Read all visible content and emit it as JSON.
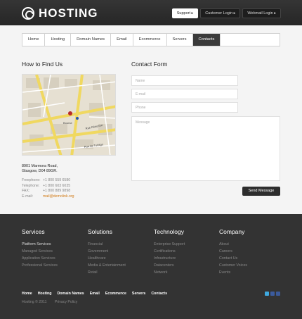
{
  "header": {
    "brand": "HOSTING",
    "links": [
      "Support",
      "Customer Login",
      "Webmail Login"
    ]
  },
  "nav": {
    "items": [
      "Home",
      "Hosting",
      "Domain Names",
      "Email",
      "Ecommerce",
      "Servers",
      "Contacts"
    ],
    "active": "Contacts"
  },
  "find_us": {
    "title": "How to Find Us",
    "address_line1": "8901 Marmora Road,",
    "address_line2": "Glasgow, D04 89GR.",
    "contacts": [
      {
        "label": "Freephone:",
        "value": "+1 800 559 6580"
      },
      {
        "label": "Telephone:",
        "value": "+1 800 603 6035"
      },
      {
        "label": "FAX:",
        "value": "+1 800 889 9898"
      },
      {
        "label": "E-mail:",
        "value": "mail@demolink.org"
      }
    ],
    "map_labels": [
      "Bourse",
      "Rue Réaumur",
      "Rue de Turbigo"
    ]
  },
  "form": {
    "title": "Contact Form",
    "name_placeholder": "Name",
    "email_placeholder": "E-mail",
    "phone_placeholder": "Phone",
    "message_placeholder": "Message",
    "send_label": "Send Message"
  },
  "footer": {
    "columns": [
      {
        "title": "Services",
        "items": [
          "Platform Services",
          "Managed Services",
          "Application Services",
          "Professional Services"
        ]
      },
      {
        "title": "Solutions",
        "items": [
          "Financial",
          "Government",
          "Healthcare",
          "Media & Entertainment",
          "Retail"
        ]
      },
      {
        "title": "Technology",
        "items": [
          "Enterprise Support",
          "Certifications",
          "Infrastructure",
          "Datacenters",
          "Network"
        ]
      },
      {
        "title": "Company",
        "items": [
          "About",
          "Careers",
          "Contact Us",
          "Customer Voices",
          "Events"
        ]
      }
    ],
    "nav": [
      "Home",
      "Hosting",
      "Domain Names",
      "Email",
      "Ecommerce",
      "Servers",
      "Contacts"
    ],
    "copyright": "Hosting © 2011",
    "privacy": "Privacy Policy"
  },
  "colors": {
    "accent": "#d07a16",
    "dark": "#333333",
    "twitter": "#3fa9e0",
    "myspace": "#3b5b9e",
    "facebook": "#3b5998"
  }
}
